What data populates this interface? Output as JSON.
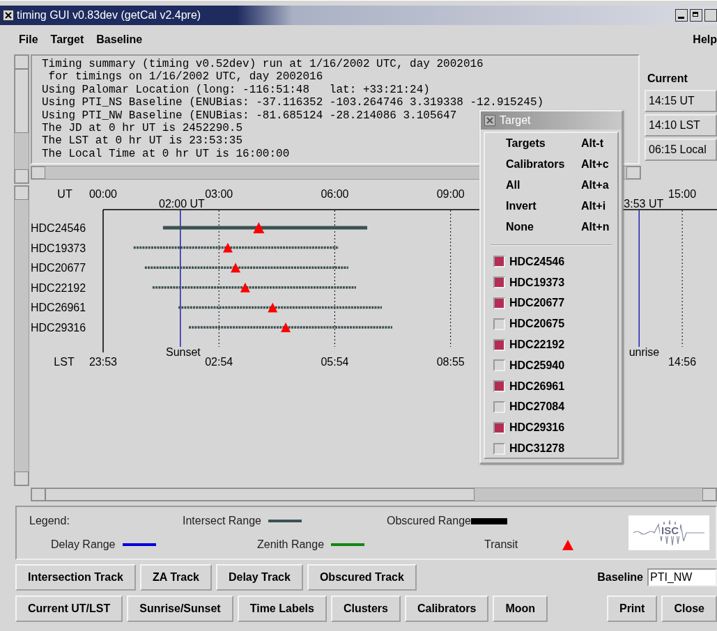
{
  "window": {
    "title": "timing GUI v0.83dev (getCal v2.4pre)"
  },
  "menubar": {
    "left": [
      "File",
      "Target",
      "Baseline"
    ],
    "right": [
      "Help"
    ]
  },
  "summary": {
    "lines": [
      "Timing summary (timing v0.52dev) run at 1/16/2002 UTC, day 2002016",
      " for timings on 1/16/2002 UTC, day 2002016",
      "Using Palomar Location (long: -116:51:48   lat: +33:21:24)",
      "Using PTI_NS Baseline (ENUBias: -37.116352 -103.264746 3.319338 -12.915245)",
      "Using PTI_NW Baseline (ENUBias: -81.685124 -28.214086 3.105647",
      "The JD at 0 hr UT is 2452290.5",
      "The LST at 0 hr UT is 23:53:35",
      "The Local Time at 0 hr UT is 16:00:00"
    ]
  },
  "current": {
    "label": "Current",
    "values": [
      "14:15 UT",
      "14:10 LST",
      "06:15 Local"
    ]
  },
  "chart": {
    "chart_data": {
      "type": "scatter",
      "orientation": "horizontal",
      "xlabel": "UT",
      "xlim": [
        0,
        15.9
      ],
      "categories": [
        "HDC24546",
        "HDC19373",
        "HDC20677",
        "HDC22192",
        "HDC26961",
        "HDC29316"
      ],
      "grid": true,
      "series": [
        {
          "type": "scatter",
          "color": "#ff0000",
          "values": [
            4.03,
            3.23,
            3.43,
            3.68,
            4.39,
            4.73
          ],
          "errors": [
            [
              1.55,
              6.84
            ],
            [
              0.79,
              6.1
            ],
            [
              1.08,
              6.35
            ],
            [
              1.28,
              6.55
            ],
            [
              1.95,
              7.22
            ],
            [
              2.22,
              7.49
            ]
          ]
        }
      ],
      "xticks": [
        {
          "value": 0,
          "label": "00:00"
        },
        {
          "value": 3,
          "label": "03:00"
        },
        {
          "value": 6,
          "label": "06:00"
        },
        {
          "value": 9,
          "label": "09:00"
        },
        {
          "value": 15,
          "label": "15:00"
        }
      ],
      "ref_lines": [
        {
          "axis": "x",
          "value": 2,
          "color": "#2020b0"
        },
        {
          "axis": "x",
          "value": 13.883,
          "color": "#2020b0"
        }
      ]
    },
    "rows": [
      {
        "kind": "solid"
      },
      {
        "kind": "beaded"
      },
      {
        "kind": "beaded"
      },
      {
        "kind": "beaded"
      },
      {
        "kind": "beaded"
      },
      {
        "kind": "beaded"
      }
    ],
    "markers": [
      {
        "top_label": "02:00 UT",
        "bottom_label": "Sunset"
      },
      {
        "top_label": "3:53 UT",
        "bottom_label": "unrise"
      }
    ],
    "lst_label": "LST",
    "lst_ticks": [
      "23:53",
      "02:54",
      "05:54",
      "08:55",
      "14:56"
    ]
  },
  "target_menu": {
    "title": "Target",
    "actions": [
      {
        "label": "Targets",
        "shortcut": "Alt-t"
      },
      {
        "label": "Calibrators",
        "shortcut": "Alt+c"
      },
      {
        "label": "All",
        "shortcut": "Alt+a"
      },
      {
        "label": "Invert",
        "shortcut": "Alt+i"
      },
      {
        "label": "None",
        "shortcut": "Alt+n"
      }
    ],
    "targets": [
      {
        "label": "HDC24546",
        "checked": true
      },
      {
        "label": "HDC19373",
        "checked": true
      },
      {
        "label": "HDC20677",
        "checked": true
      },
      {
        "label": "HDC20675",
        "checked": false
      },
      {
        "label": "HDC22192",
        "checked": true
      },
      {
        "label": "HDC25940",
        "checked": false
      },
      {
        "label": "HDC26961",
        "checked": true
      },
      {
        "label": "HDC27084",
        "checked": false
      },
      {
        "label": "HDC29316",
        "checked": true
      },
      {
        "label": "HDC31278",
        "checked": false
      }
    ]
  },
  "legend": {
    "title": "Legend:",
    "logo_text": "ISC",
    "rows": [
      [
        {
          "label": "Intersect Range",
          "kind": "line",
          "color": "#3c5252"
        },
        {
          "label": "Obscured Range",
          "kind": "bar",
          "color": "#000000"
        }
      ],
      [
        {
          "label": "Delay Range",
          "kind": "line",
          "color": "#0000dd"
        },
        {
          "label": "Zenith Range",
          "kind": "line",
          "color": "#118811"
        },
        {
          "label": "Transit",
          "kind": "triangle",
          "color": "#ff0000"
        }
      ]
    ]
  },
  "toolbar1": {
    "buttons": [
      "Intersection Track",
      "ZA Track",
      "Delay Track",
      "Obscured Track"
    ],
    "field_label": "Baseline",
    "field_value": "PTI_NW"
  },
  "toolbar2": {
    "left": [
      "Current UT/LST",
      "Sunrise/Sunset",
      "Time Labels",
      "Clusters",
      "Calibrators",
      "Moon"
    ],
    "right": [
      "Print",
      "Close"
    ]
  }
}
